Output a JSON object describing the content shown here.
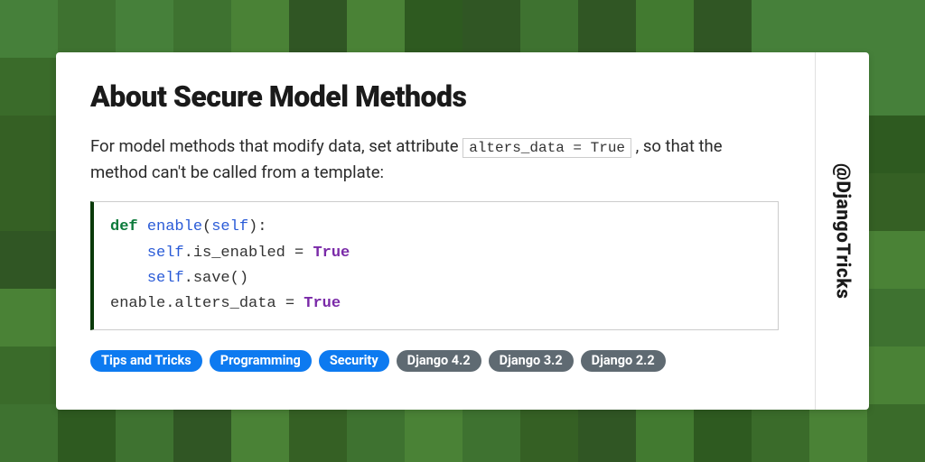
{
  "title": "About Secure Model Methods",
  "description": {
    "part1": "For model methods that modify data, set attribute ",
    "inline_code": "alters_data = True",
    "part2": " , so that the method can't be called from a template:"
  },
  "code": {
    "line1_def": "def",
    "line1_fn": "enable",
    "line1_self": "self",
    "line2_self": "self",
    "line2_rest": ".is_enabled = ",
    "line2_bool": "True",
    "line3_self": "self",
    "line3_rest": ".save()",
    "line4_pre": "enable.alters_data = ",
    "line4_bool": "True"
  },
  "tags": {
    "blue": [
      "Tips and Tricks",
      "Programming",
      "Security"
    ],
    "grey": [
      "Django 4.2",
      "Django 3.2",
      "Django 2.2"
    ]
  },
  "handle": "@DjangoTricks",
  "bg_shades": [
    "#2e5a20",
    "#3a6b2a",
    "#427a30",
    "#356024",
    "#4a8236",
    "#305624",
    "#3e7230",
    "#46803a"
  ]
}
